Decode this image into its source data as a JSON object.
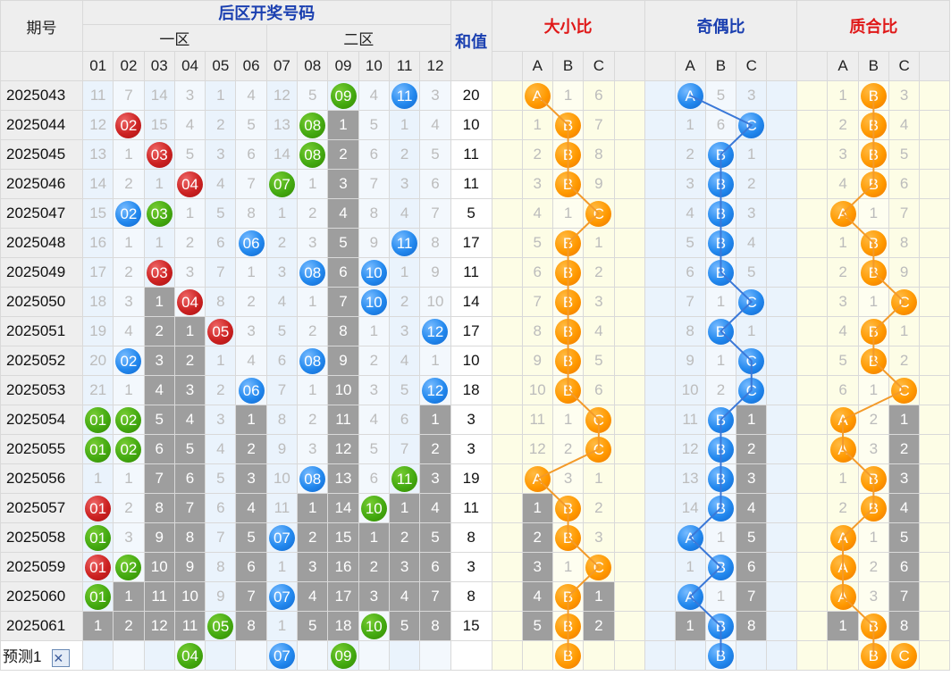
{
  "header": {
    "issue_label": "期号",
    "back_zone_title": "后区开奖号码",
    "zone1_label": "一区",
    "zone2_label": "二区",
    "sum_label": "和值",
    "big_small_title": "大小比",
    "odd_even_title": "奇偶比",
    "prime_comp_title": "质合比",
    "numbers": [
      "01",
      "02",
      "03",
      "04",
      "05",
      "06",
      "07",
      "08",
      "09",
      "10",
      "11",
      "12"
    ],
    "abc": [
      "A",
      "B",
      "C"
    ]
  },
  "colors": {
    "red_ball": "#cc2222",
    "green_ball": "#44aa11",
    "blue_ball": "#2288ee",
    "orange_ball": "#ff9900",
    "fill_gray": "#9e9e9e",
    "title_blue": "#1a3fb0",
    "title_red": "#e01818"
  },
  "rows": [
    {
      "issue": "2025043",
      "nums": [
        "11",
        "7",
        "14",
        "3",
        "1",
        "4",
        "12",
        "5",
        "09",
        "4",
        "11",
        "3"
      ],
      "sum": "20",
      "bs": [
        "A",
        "1",
        "6"
      ],
      "oe": [
        "A",
        "5",
        "3"
      ],
      "pc": [
        "1",
        "B",
        "3"
      ]
    },
    {
      "issue": "2025044",
      "nums": [
        "12",
        "02",
        "15",
        "4",
        "2",
        "5",
        "13",
        "08",
        "1",
        "5",
        "1",
        "4"
      ],
      "sum": "10",
      "bs": [
        "1",
        "B",
        "7"
      ],
      "oe": [
        "1",
        "6",
        "C"
      ],
      "pc": [
        "2",
        "B",
        "4"
      ]
    },
    {
      "issue": "2025045",
      "nums": [
        "13",
        "1",
        "03",
        "5",
        "3",
        "6",
        "14",
        "08",
        "2",
        "6",
        "2",
        "5"
      ],
      "sum": "11",
      "bs": [
        "2",
        "B",
        "8"
      ],
      "oe": [
        "2",
        "B",
        "1"
      ],
      "pc": [
        "3",
        "B",
        "5"
      ]
    },
    {
      "issue": "2025046",
      "nums": [
        "14",
        "2",
        "1",
        "04",
        "4",
        "7",
        "07",
        "1",
        "3",
        "7",
        "3",
        "6"
      ],
      "sum": "11",
      "bs": [
        "3",
        "B",
        "9"
      ],
      "oe": [
        "3",
        "B",
        "2"
      ],
      "pc": [
        "4",
        "B",
        "6"
      ]
    },
    {
      "issue": "2025047",
      "nums": [
        "15",
        "02",
        "03",
        "1",
        "5",
        "8",
        "1",
        "2",
        "4",
        "8",
        "4",
        "7"
      ],
      "sum": "5",
      "bs": [
        "4",
        "1",
        "C"
      ],
      "oe": [
        "4",
        "B",
        "3"
      ],
      "pc": [
        "A",
        "1",
        "7"
      ]
    },
    {
      "issue": "2025048",
      "nums": [
        "16",
        "1",
        "1",
        "2",
        "6",
        "06",
        "2",
        "3",
        "5",
        "9",
        "11",
        "8"
      ],
      "sum": "17",
      "bs": [
        "5",
        "B",
        "1"
      ],
      "oe": [
        "5",
        "B",
        "4"
      ],
      "pc": [
        "1",
        "B",
        "8"
      ]
    },
    {
      "issue": "2025049",
      "nums": [
        "17",
        "2",
        "03",
        "3",
        "7",
        "1",
        "3",
        "08",
        "6",
        "10",
        "1",
        "9"
      ],
      "sum": "11",
      "bs": [
        "6",
        "B",
        "2"
      ],
      "oe": [
        "6",
        "B",
        "5"
      ],
      "pc": [
        "2",
        "B",
        "9"
      ]
    },
    {
      "issue": "2025050",
      "nums": [
        "18",
        "3",
        "1",
        "04",
        "8",
        "2",
        "4",
        "1",
        "7",
        "10",
        "2",
        "10"
      ],
      "sum": "14",
      "bs": [
        "7",
        "B",
        "3"
      ],
      "oe": [
        "7",
        "1",
        "C"
      ],
      "pc": [
        "3",
        "1",
        "C"
      ]
    },
    {
      "issue": "2025051",
      "nums": [
        "19",
        "4",
        "2",
        "1",
        "05",
        "3",
        "5",
        "2",
        "8",
        "1",
        "3",
        "12"
      ],
      "sum": "17",
      "bs": [
        "8",
        "B",
        "4"
      ],
      "oe": [
        "8",
        "B",
        "1"
      ],
      "pc": [
        "4",
        "B",
        "1"
      ]
    },
    {
      "issue": "2025052",
      "nums": [
        "20",
        "02",
        "3",
        "2",
        "1",
        "4",
        "6",
        "08",
        "9",
        "2",
        "4",
        "1"
      ],
      "sum": "10",
      "bs": [
        "9",
        "B",
        "5"
      ],
      "oe": [
        "9",
        "1",
        "C"
      ],
      "pc": [
        "5",
        "B",
        "2"
      ]
    },
    {
      "issue": "2025053",
      "nums": [
        "21",
        "1",
        "4",
        "3",
        "2",
        "06",
        "7",
        "1",
        "10",
        "3",
        "5",
        "12"
      ],
      "sum": "18",
      "bs": [
        "10",
        "B",
        "6"
      ],
      "oe": [
        "10",
        "2",
        "C"
      ],
      "pc": [
        "6",
        "1",
        "C"
      ]
    },
    {
      "issue": "2025054",
      "nums": [
        "01",
        "02",
        "5",
        "4",
        "3",
        "1",
        "8",
        "2",
        "11",
        "4",
        "6",
        "1"
      ],
      "sum": "3",
      "bs": [
        "11",
        "1",
        "C"
      ],
      "oe": [
        "11",
        "B",
        "1"
      ],
      "pc": [
        "A",
        "2",
        "1"
      ]
    },
    {
      "issue": "2025055",
      "nums": [
        "01",
        "02",
        "6",
        "5",
        "4",
        "2",
        "9",
        "3",
        "12",
        "5",
        "7",
        "2"
      ],
      "sum": "3",
      "bs": [
        "12",
        "2",
        "C"
      ],
      "oe": [
        "12",
        "B",
        "2"
      ],
      "pc": [
        "A",
        "3",
        "2"
      ]
    },
    {
      "issue": "2025056",
      "nums": [
        "1",
        "1",
        "7",
        "6",
        "5",
        "3",
        "10",
        "08",
        "13",
        "6",
        "11",
        "3"
      ],
      "sum": "19",
      "bs": [
        "A",
        "3",
        "1"
      ],
      "oe": [
        "13",
        "B",
        "3"
      ],
      "pc": [
        "1",
        "B",
        "3"
      ]
    },
    {
      "issue": "2025057",
      "nums": [
        "01",
        "2",
        "8",
        "7",
        "6",
        "4",
        "11",
        "1",
        "14",
        "10",
        "1",
        "4"
      ],
      "sum": "11",
      "bs": [
        "1",
        "B",
        "2"
      ],
      "oe": [
        "14",
        "B",
        "4"
      ],
      "pc": [
        "2",
        "B",
        "4"
      ]
    },
    {
      "issue": "2025058",
      "nums": [
        "01",
        "3",
        "9",
        "8",
        "7",
        "5",
        "07",
        "2",
        "15",
        "1",
        "2",
        "5"
      ],
      "sum": "8",
      "bs": [
        "2",
        "B",
        "3"
      ],
      "oe": [
        "A",
        "1",
        "5"
      ],
      "pc": [
        "A",
        "1",
        "5"
      ]
    },
    {
      "issue": "2025059",
      "nums": [
        "01",
        "02",
        "10",
        "9",
        "8",
        "6",
        "1",
        "3",
        "16",
        "2",
        "3",
        "6"
      ],
      "sum": "3",
      "bs": [
        "3",
        "1",
        "C"
      ],
      "oe": [
        "1",
        "B",
        "6"
      ],
      "pc": [
        "A",
        "2",
        "6"
      ]
    },
    {
      "issue": "2025060",
      "nums": [
        "01",
        "1",
        "11",
        "10",
        "9",
        "7",
        "07",
        "4",
        "17",
        "3",
        "4",
        "7"
      ],
      "sum": "8",
      "bs": [
        "4",
        "B",
        "1"
      ],
      "oe": [
        "A",
        "1",
        "7"
      ],
      "pc": [
        "A",
        "3",
        "7"
      ]
    },
    {
      "issue": "2025061",
      "nums": [
        "1",
        "2",
        "12",
        "11",
        "05",
        "8",
        "1",
        "5",
        "18",
        "10",
        "5",
        "8"
      ],
      "sum": "15",
      "bs": [
        "5",
        "B",
        "2"
      ],
      "oe": [
        "1",
        "B",
        "8"
      ],
      "pc": [
        "1",
        "B",
        "8"
      ]
    }
  ],
  "prediction": {
    "label": "预测1",
    "close_glyph": "✕",
    "balls": [
      "04",
      "07",
      "09"
    ],
    "bs": [
      "B"
    ],
    "oe": [
      "B"
    ],
    "pc": [
      "B",
      "C"
    ]
  }
}
